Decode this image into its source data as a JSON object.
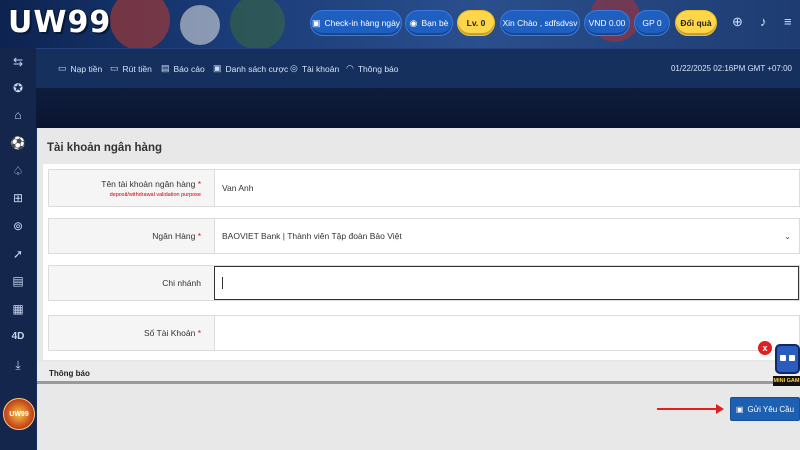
{
  "header": {
    "logo": "UW99",
    "checkin_label": "Check-in hàng ngày",
    "friends_label": "Bạn bè",
    "level_label": "Lv. 0",
    "greeting": "Xin Chào , sdfsdvsv",
    "balance": "VND 0.00",
    "gp": "GP 0",
    "redeem_label": "Đổi quà"
  },
  "nav": {
    "items": [
      {
        "label": "Nạp tiền",
        "icon": "deposit-icon"
      },
      {
        "label": "Rút tiền",
        "icon": "withdraw-icon"
      },
      {
        "label": "Báo cáo",
        "icon": "report-icon"
      },
      {
        "label": "Danh sách cược",
        "icon": "bet-list-icon"
      },
      {
        "label": "Tài khoản",
        "icon": "account-icon"
      },
      {
        "label": "Thông báo",
        "icon": "notification-icon"
      }
    ],
    "datetime": "01/22/2025 02:16PM GMT +07:00"
  },
  "sidebar": {
    "items": [
      "transfer-icon",
      "wheel-icon",
      "home-icon",
      "soccer-icon",
      "cards-icon",
      "gamepad-icon",
      "coin-icon",
      "rocket-icon",
      "slot-icon",
      "gift-icon",
      "4d-icon",
      "download-icon"
    ],
    "item_4d_text": "4D",
    "logo_text": "UW99"
  },
  "panel": {
    "title": "Tài khoản ngân hàng",
    "fields": {
      "account_name": {
        "label": "Tên tài khoản ngân hàng",
        "required_mark": "*",
        "note": "deposit/withdrawal validation purpose",
        "value": "Van Anh"
      },
      "bank": {
        "label": "Ngân Hàng",
        "required_mark": "*",
        "value": "BAOVIET Bank | Thành viên Tập đoàn Bảo Việt"
      },
      "branch": {
        "label": "Chi nhánh",
        "value": ""
      },
      "account_number": {
        "label": "Số Tài Khoản",
        "required_mark": "*",
        "value": ""
      }
    },
    "notice_label": "Thông báo",
    "submit_label": "Gửi Yêu Cầu"
  },
  "mini_game": {
    "label": "MINI GAM",
    "close": "x"
  },
  "colors": {
    "header_bg": "#1b3d7a",
    "pill_blue": "#1f5fc0",
    "pill_yellow": "#ffd54a",
    "submit_bg": "#1d5fb0",
    "required": "#d11111",
    "arrow": "#e02020"
  }
}
